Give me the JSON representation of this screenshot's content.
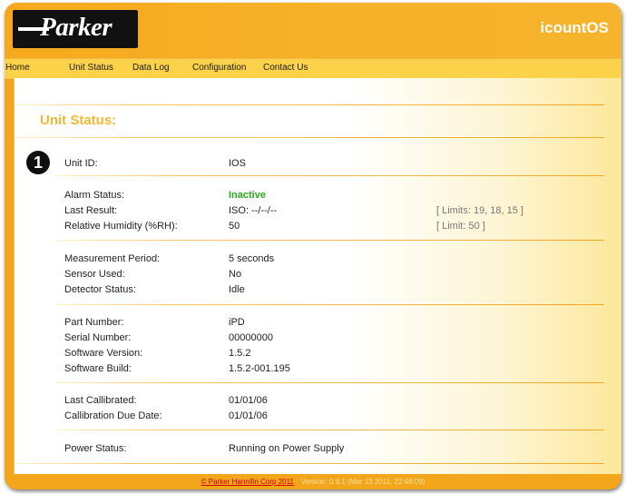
{
  "header": {
    "brand": "Parker",
    "app_title": "icountOS"
  },
  "nav": [
    "Home",
    "Unit Status",
    "Data Log",
    "Configuration",
    "Contact Us"
  ],
  "section": {
    "title": "Unit Status:",
    "callout_number": "1"
  },
  "status": {
    "unit_id": {
      "label": "Unit ID:",
      "value": "IOS"
    },
    "alarm_status": {
      "label": "Alarm Status:",
      "value": "Inactive"
    },
    "last_result": {
      "label": "Last Result:",
      "value": "ISO: --/--/--",
      "limit": "[ Limits: 19, 18, 15 ]"
    },
    "relative_humidity": {
      "label": "Relative Humidity (%RH):",
      "value": "50",
      "limit": "[ Limit: 50 ]"
    },
    "measurement_period": {
      "label": "Measurement Period:",
      "value": "5 seconds"
    },
    "sensor_used": {
      "label": "Sensor Used:",
      "value": "No"
    },
    "detector_status": {
      "label": "Detector Status:",
      "value": "Idle"
    },
    "part_number": {
      "label": "Part Number:",
      "value": "iPD"
    },
    "serial_number": {
      "label": "Serial Number:",
      "value": "00000000"
    },
    "software_version": {
      "label": "Software Version:",
      "value": "1.5.2"
    },
    "software_build": {
      "label": "Software Build:",
      "value": "1.5.2-001.195"
    },
    "last_calibrated": {
      "label": "Last Callibrated:",
      "value": "01/01/06"
    },
    "calibration_due": {
      "label": "Callibration Due Date:",
      "value": "01/01/06"
    },
    "power_status": {
      "label": "Power Status:",
      "value": "Running on Power Supply"
    }
  },
  "footer": {
    "copyright": "© Parker Hannifin Corp 2011",
    "version": "Version: 0.9.1 (Mar 13 2011, 22:48:09)"
  },
  "colors": {
    "accent": "#f3a51c",
    "nav_bg": "#fbd24a",
    "section_title": "#f2b733",
    "status_ok": "#29a81b"
  }
}
